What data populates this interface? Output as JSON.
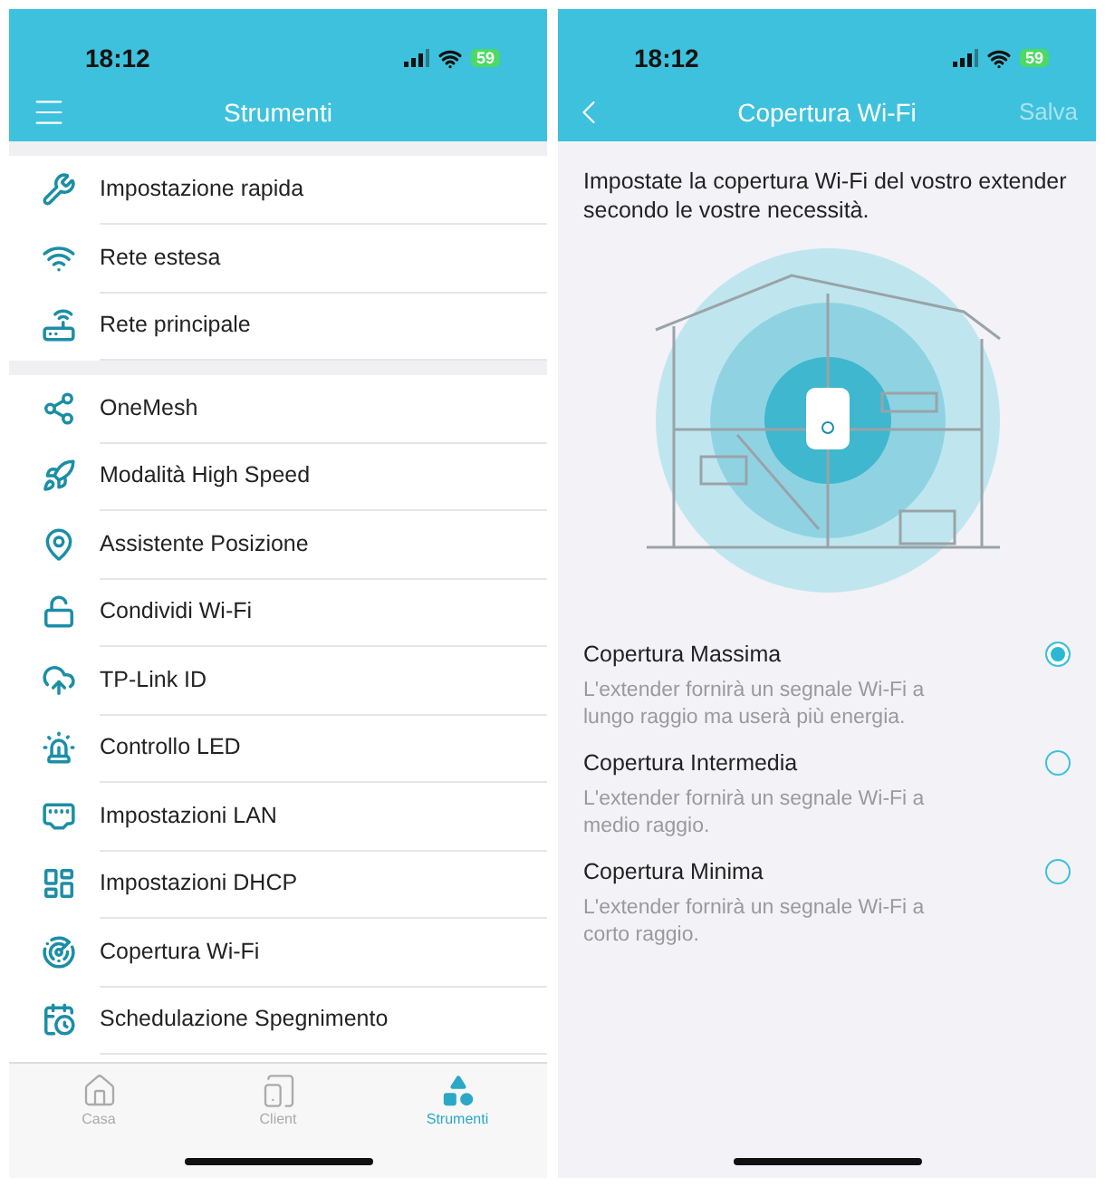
{
  "left_screen": {
    "status_bar": {
      "time": "18:12",
      "battery": "59"
    },
    "title": "Strumenti",
    "groups": [
      {
        "items": [
          {
            "label": "Impostazione rapida"
          },
          {
            "label": "Rete estesa"
          },
          {
            "label": "Rete principale"
          }
        ]
      },
      {
        "items": [
          {
            "label": "OneMesh"
          },
          {
            "label": "Modalità High Speed"
          },
          {
            "label": "Assistente Posizione"
          },
          {
            "label": "Condividi Wi-Fi"
          },
          {
            "label": "TP-Link ID"
          },
          {
            "label": "Controllo LED"
          },
          {
            "label": "Impostazioni LAN"
          },
          {
            "label": "Impostazioni DHCP"
          },
          {
            "label": "Copertura Wi-Fi"
          },
          {
            "label": "Schedulazione Spegnimento"
          }
        ]
      }
    ],
    "tabs": [
      {
        "label": "Casa",
        "selected": false
      },
      {
        "label": "Client",
        "selected": false
      },
      {
        "label": "Strumenti",
        "selected": true
      }
    ]
  },
  "right_screen": {
    "status_bar": {
      "time": "18:12",
      "battery": "59"
    },
    "title": "Copertura Wi-Fi",
    "save": "Salva",
    "intro": "Impostate la copertura Wi-Fi del vostro extender secondo le vostre necessità.",
    "options": [
      {
        "title": "Copertura Massima",
        "description": "L'extender fornirà un segnale Wi-Fi a lungo raggio ma userà più energia.",
        "selected": true
      },
      {
        "title": "Copertura Intermedia",
        "description": "L'extender fornirà un segnale Wi-Fi a medio raggio.",
        "selected": false
      },
      {
        "title": "Copertura Minima",
        "description": "L'extender fornirà un segnale Wi-Fi a corto raggio.",
        "selected": false
      }
    ]
  }
}
